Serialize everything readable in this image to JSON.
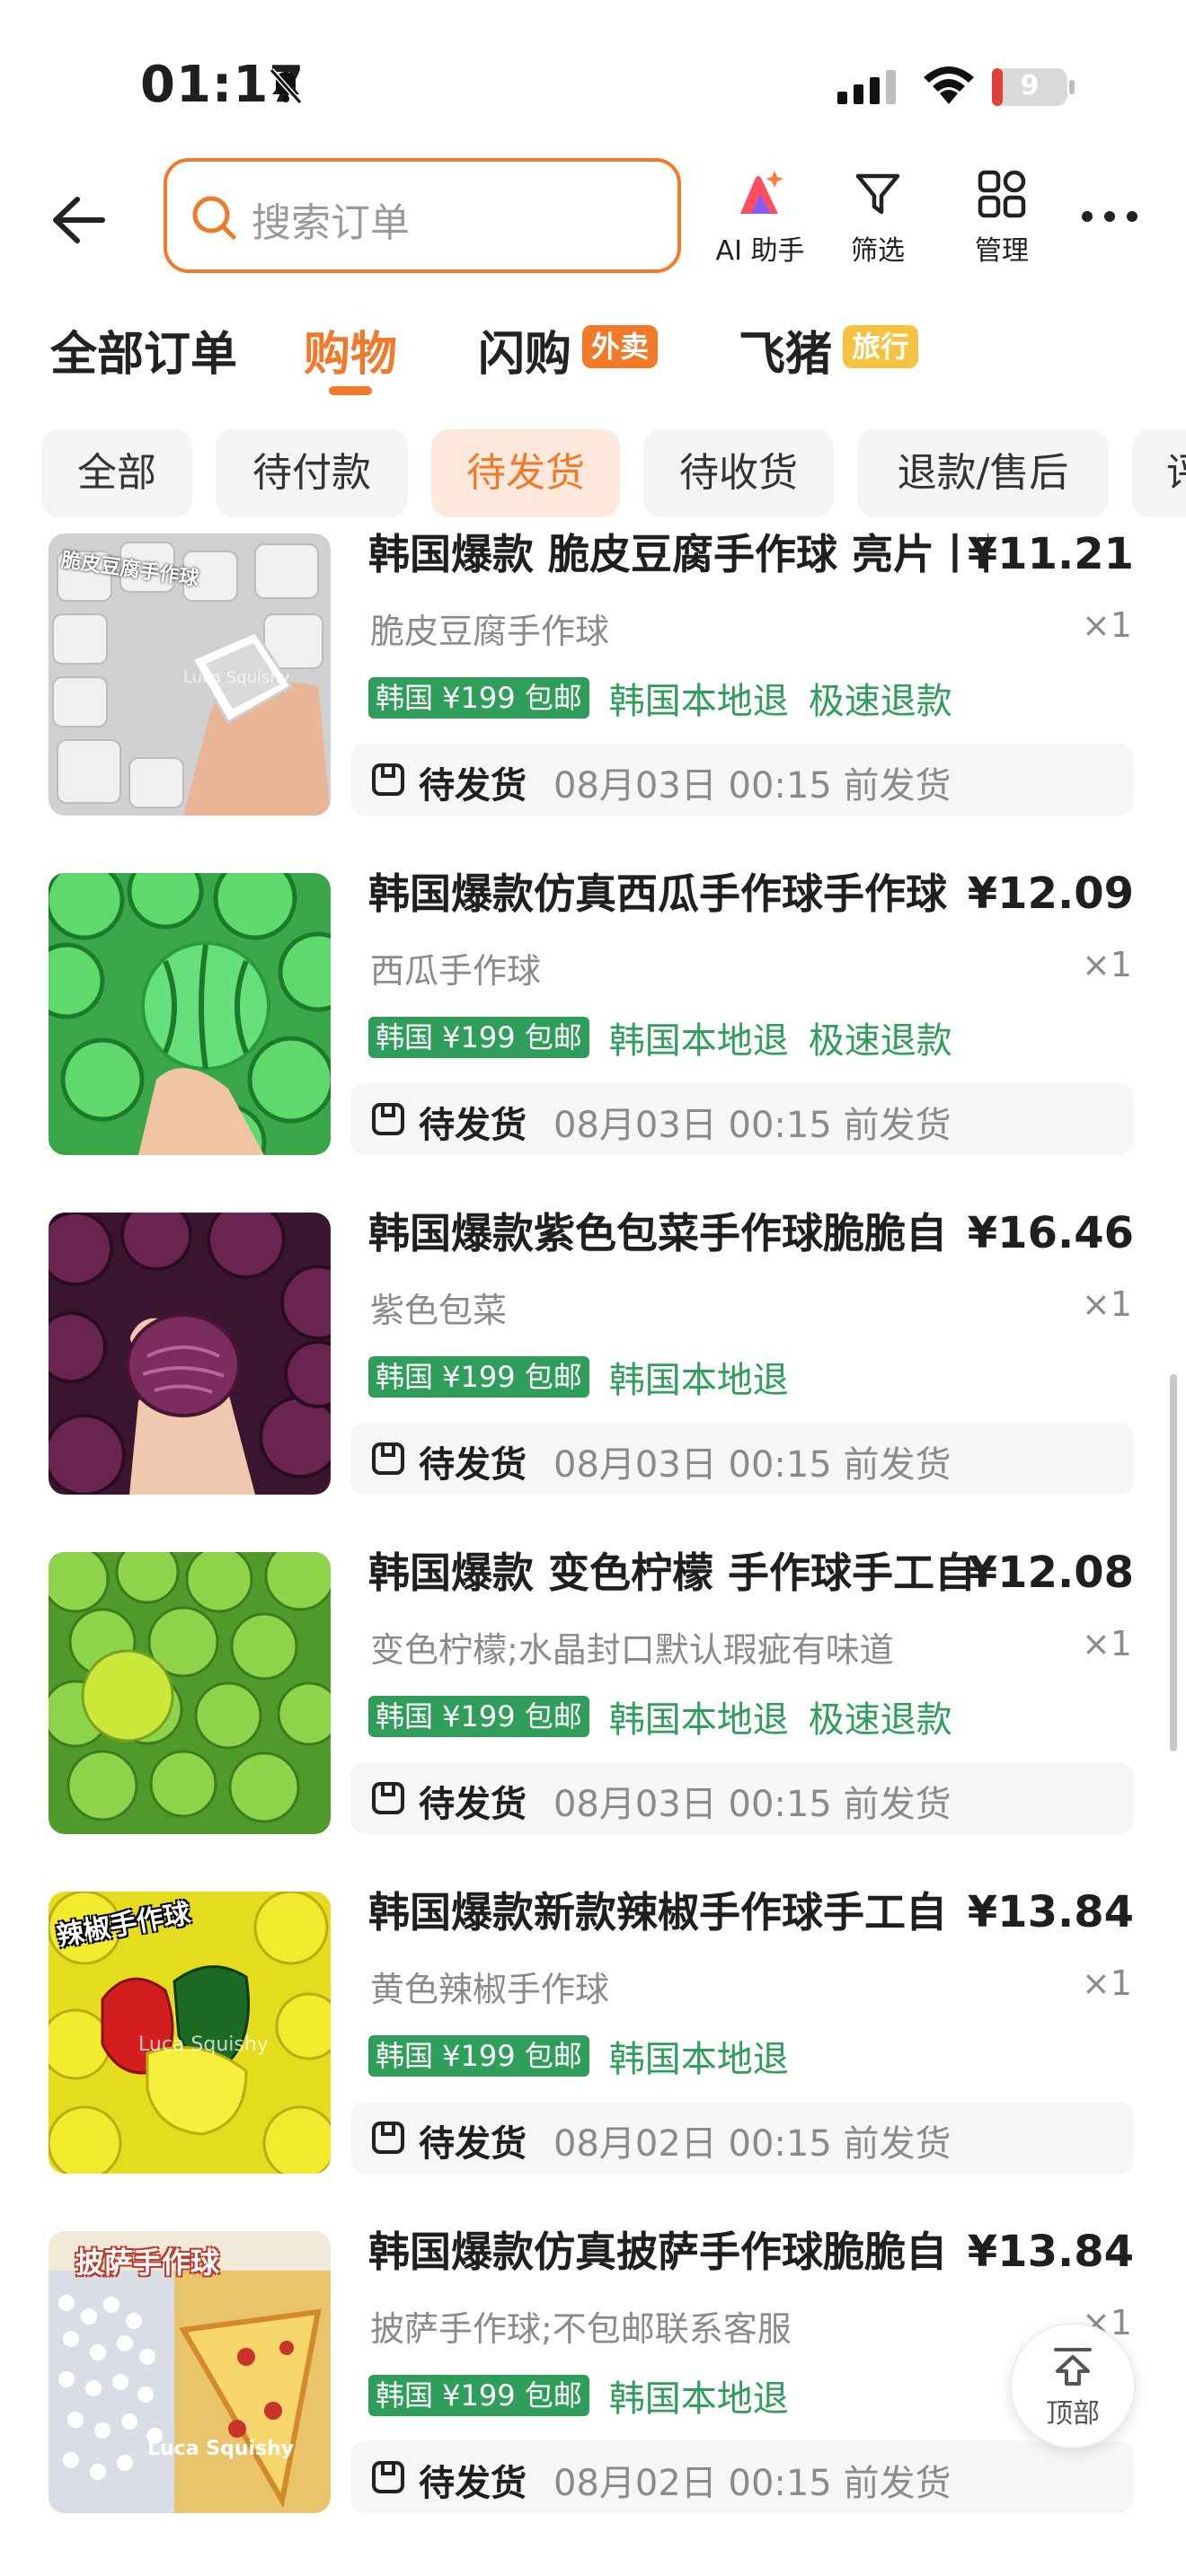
{
  "status_bar": {
    "time": "01:17",
    "battery": "9"
  },
  "nav": {
    "search_placeholder": "搜索订单",
    "tools": [
      {
        "label": "AI 助手",
        "icon": "ai-assistant-icon"
      },
      {
        "label": "筛选",
        "icon": "filter-icon"
      },
      {
        "label": "管理",
        "icon": "manage-grid-icon"
      }
    ]
  },
  "top_tabs": {
    "all": "全部订单",
    "shopping": "购物",
    "flash": "闪购",
    "flash_badge": "外卖",
    "fliggy": "飞猪",
    "fliggy_badge": "旅行"
  },
  "chips": [
    "全部",
    "待付款",
    "待发货",
    "待收货",
    "退款/售后",
    "评"
  ],
  "active_chip": "待发货",
  "orders": [
    {
      "title": "韩国爆款  脆皮豆腐手作球 亮片丨花",
      "price": "¥11.21",
      "spec": "脆皮豆腐手作球",
      "qty": "×1",
      "ship_tag": "韩国 ¥199 包邮",
      "tag1": "韩国本地退",
      "tag2": "极速退款",
      "status": "待发货",
      "deadline": "08月03日 00:15 前发货",
      "thumb_text": "脆皮豆腐手作球",
      "thumb_watermark": "Luca Squishy"
    },
    {
      "title": "韩国爆款仿真西瓜手作球手作球",
      "price": "¥12.09",
      "spec": "西瓜手作球",
      "qty": "×1",
      "ship_tag": "韩国 ¥199 包邮",
      "tag1": "韩国本地退",
      "tag2": "极速退款",
      "status": "待发货",
      "deadline": "08月03日 00:15 前发货"
    },
    {
      "title": "韩国爆款紫色包菜手作球脆脆自",
      "price": "¥16.46",
      "spec": "紫色包菜",
      "qty": "×1",
      "ship_tag": "韩国 ¥199 包邮",
      "tag1": "韩国本地退",
      "tag2": "",
      "status": "待发货",
      "deadline": "08月03日 00:15 前发货"
    },
    {
      "title": "韩国爆款  变色柠檬 手作球手工自",
      "price": "¥12.08",
      "spec": "变色柠檬;水晶封口默认瑕疵有味道",
      "qty": "×1",
      "ship_tag": "韩国 ¥199 包邮",
      "tag1": "韩国本地退",
      "tag2": "极速退款",
      "status": "待发货",
      "deadline": "08月03日 00:15 前发货"
    },
    {
      "title": "韩国爆款新款辣椒手作球手工自",
      "price": "¥13.84",
      "spec": "黄色辣椒手作球",
      "qty": "×1",
      "ship_tag": "韩国 ¥199 包邮",
      "tag1": "韩国本地退",
      "tag2": "",
      "status": "待发货",
      "deadline": "08月02日 00:15 前发货",
      "thumb_text": "辣椒手作球",
      "thumb_watermark": "Luca Squishy"
    },
    {
      "title": "韩国爆款仿真披萨手作球脆脆自",
      "price": "¥13.84",
      "spec": "披萨手作球;不包邮联系客服",
      "qty": "×1",
      "ship_tag": "韩国 ¥199 包邮",
      "tag1": "韩国本地退",
      "tag2": "",
      "status": "待发货",
      "deadline": "08月02日 00:15 前发货",
      "thumb_text": "披萨手作球",
      "thumb_watermark": "Luca Squishy"
    }
  ],
  "back_to_top_label": "顶部",
  "colors": {
    "accent": "#f07a2a",
    "green": "#2f9e5a",
    "fliggy_badge": "#f5c242"
  }
}
